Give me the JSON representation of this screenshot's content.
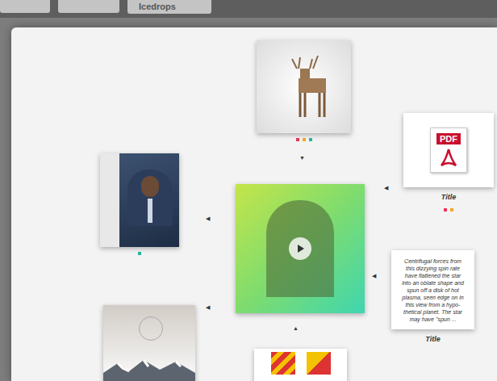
{
  "top_bar": {
    "buttons": [
      {
        "label": "Icedrops",
        "selected": false
      }
    ]
  },
  "cards": [
    {
      "kind": "image",
      "dots": [
        {
          "color": "#e8365d"
        },
        {
          "color": "#f5a623"
        },
        {
          "color": "#26b5a6"
        }
      ]
    },
    {
      "kind": "pdf",
      "icon_label": "PDF",
      "title": "Title",
      "dots": [
        {
          "color": "#e8365d"
        },
        {
          "color": "#f5a623"
        }
      ]
    },
    {
      "kind": "image",
      "dots": [
        {
          "color": "#26b5a6"
        }
      ]
    },
    {
      "kind": "video",
      "dots": []
    },
    {
      "kind": "text",
      "lines": [
        "Centrifugal forces from",
        "this dizzying spin rate",
        "have flattened the star",
        "into an oblate shape and",
        "spun off a disk of hot",
        "plasma, seen edge on in",
        "this view from a hypo-",
        "thetical planet. The star",
        "may have \"spun ..."
      ],
      "title": "Title",
      "dots": []
    },
    {
      "kind": "image",
      "dots": []
    },
    {
      "kind": "image",
      "dots": []
    }
  ],
  "arrows": [
    "▼",
    "◀",
    "◀",
    "◀",
    "◀",
    "▲"
  ]
}
